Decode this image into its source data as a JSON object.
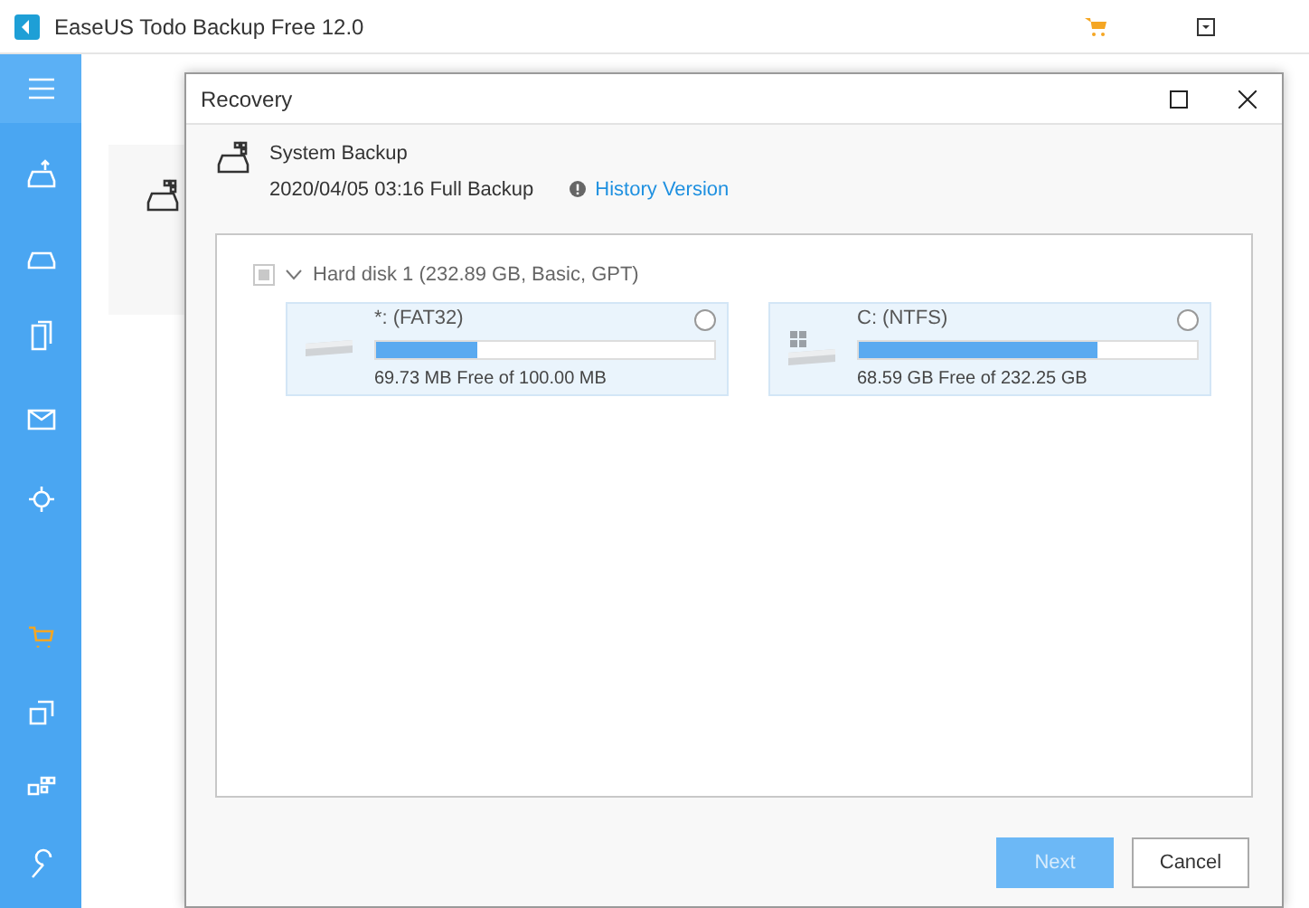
{
  "window": {
    "title": "EaseUS Todo Backup Free 12.0"
  },
  "dialog": {
    "title": "Recovery",
    "backup_name": "System Backup",
    "backup_info": "2020/04/05 03:16 Full Backup",
    "history_link": "History Version",
    "disk": {
      "label": "Hard disk 1 (232.89 GB, Basic, GPT)",
      "checked": false,
      "expanded": true,
      "partitions": [
        {
          "kind": "plain",
          "name": "*: (FAT32)",
          "level": 0.3,
          "free": "69.73 MB Free of 100.00 MB",
          "selected": false
        },
        {
          "kind": "system",
          "name": "C: (NTFS)",
          "level": 0.705,
          "free": "68.59 GB Free of 232.25 GB",
          "selected": false
        }
      ]
    },
    "buttons": [
      {
        "label": "Next",
        "kind": "primary",
        "disabled": true
      },
      {
        "label": "Cancel",
        "kind": "secondary",
        "disabled": false
      }
    ]
  }
}
